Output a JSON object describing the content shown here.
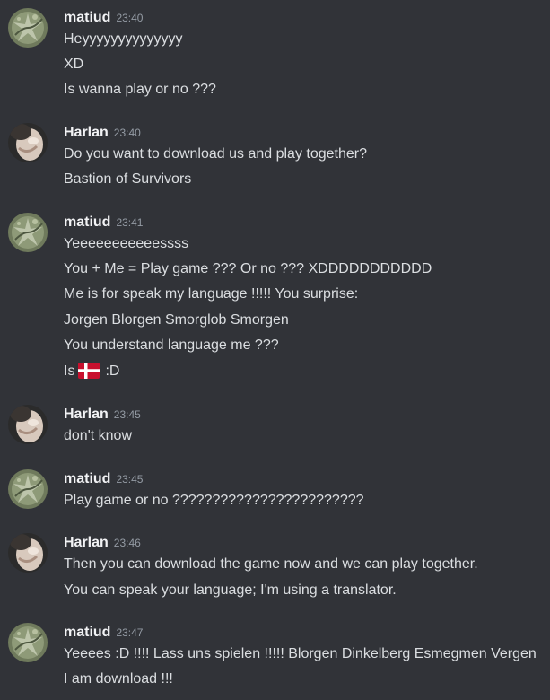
{
  "colors": {
    "background": "#313338",
    "author": "#f2f3f5",
    "timestamp": "#949ba4",
    "message_text": "#dbdee1"
  },
  "groups": [
    {
      "author": "matiud",
      "avatar": "plant-avatar",
      "time": "23:40",
      "messages": [
        "Heyyyyyyyyyyyyyy",
        "XD",
        "Is wanna play or no ???"
      ]
    },
    {
      "author": "Harlan",
      "avatar": "harlan-avatar",
      "time": "23:40",
      "messages": [
        "Do you want to download us and play together?",
        "Bastion of Survivors"
      ]
    },
    {
      "author": "matiud",
      "avatar": "plant-avatar",
      "time": "23:41",
      "messages": [
        "Yeeeeeeeeeeessss",
        "You + Me = Play game ??? Or no ??? XDDDDDDDDDDD",
        "Me is for speak my language !!!!! You surprise:",
        "Jorgen Blorgen Smorglob Smorgen",
        "You understand language me ???"
      ],
      "flag_line": {
        "before": "Is",
        "emoji": "denmark-flag-icon",
        "after": ":D"
      }
    },
    {
      "author": "Harlan",
      "avatar": "harlan-avatar",
      "time": "23:45",
      "messages": [
        "don't know"
      ]
    },
    {
      "author": "matiud",
      "avatar": "plant-avatar",
      "time": "23:45",
      "messages": [
        "Play game or no ????????????????????????"
      ]
    },
    {
      "author": "Harlan",
      "avatar": "harlan-avatar",
      "time": "23:46",
      "messages": [
        "Then you can download the game now and we can play together.",
        "You can speak your language; I'm using a translator."
      ]
    },
    {
      "author": "matiud",
      "avatar": "plant-avatar",
      "time": "23:47",
      "messages": [
        "Yeeees :D !!!! Lass uns spielen !!!!! Blorgen Dinkelberg Esmegmen Vergen",
        "I am download !!!"
      ]
    }
  ]
}
